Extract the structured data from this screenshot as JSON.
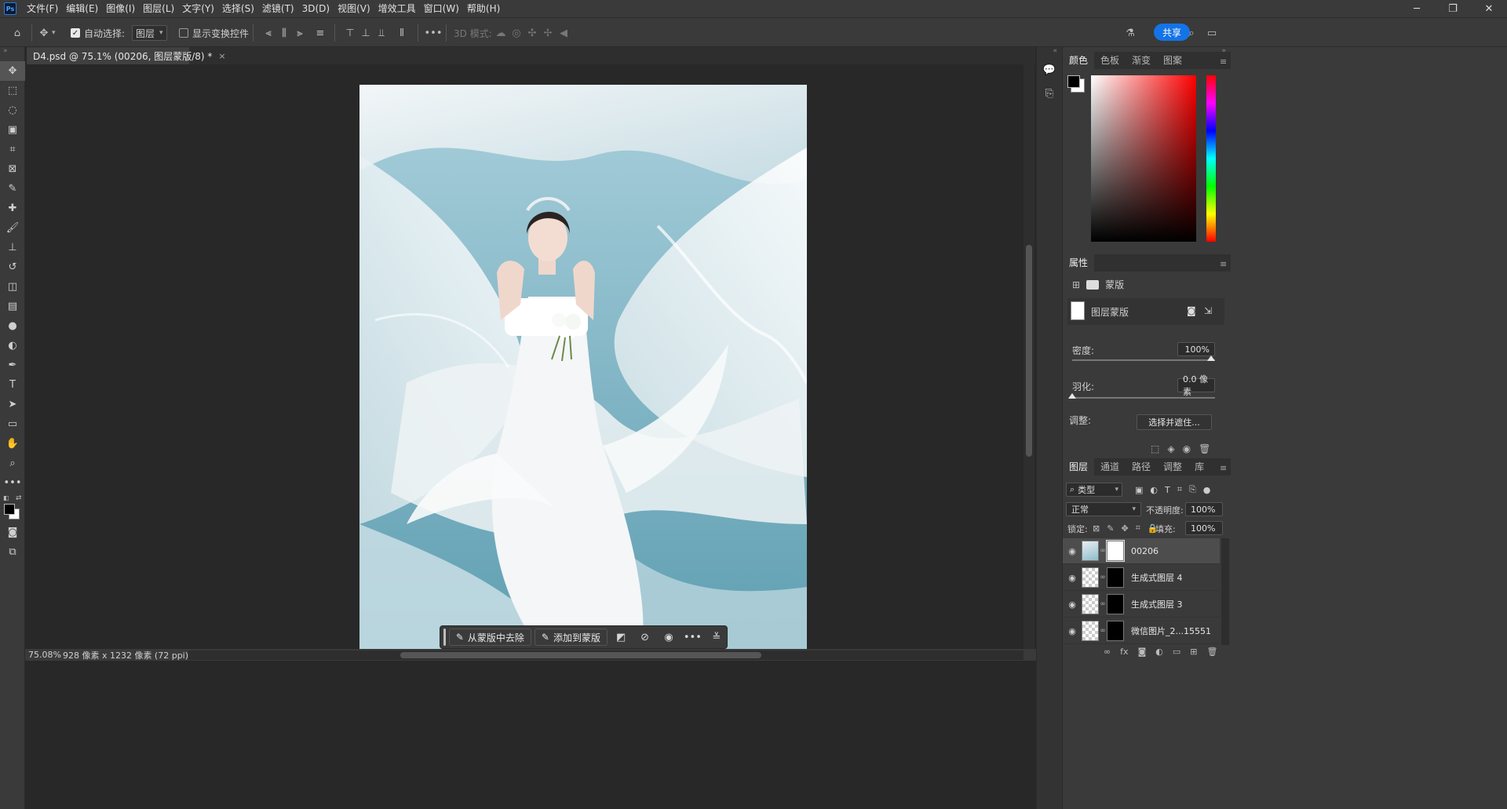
{
  "app": {
    "logo": "Ps"
  },
  "menu": [
    "文件(F)",
    "编辑(E)",
    "图像(I)",
    "图层(L)",
    "文字(Y)",
    "选择(S)",
    "滤镜(T)",
    "3D(D)",
    "视图(V)",
    "增效工具",
    "窗口(W)",
    "帮助(H)"
  ],
  "window_controls": {
    "minimize": "─",
    "restore": "❐",
    "close": "✕"
  },
  "options": {
    "auto_select_label": "自动选择:",
    "auto_select_checked": true,
    "layer_dropdown": "图层",
    "show_transform_label": "显示变换控件",
    "mode_3d_label": "3D 模式:",
    "share_label": "共享"
  },
  "document": {
    "tab_title": "D4.psd @ 75.1% (00206, 图层蒙版/8) *",
    "zoom": "75.08%",
    "size_info": "928 像素 x 1232 像素 (72 ppi)"
  },
  "context_bar": {
    "remove_label": "从蒙版中去除",
    "add_label": "添加到蒙版"
  },
  "color_panel": {
    "tabs": [
      "颜色",
      "色板",
      "渐变",
      "图案"
    ],
    "active": "颜色"
  },
  "properties": {
    "title": "属性",
    "mask_label": "蒙版",
    "layer_mask_label": "图层蒙版",
    "density_label": "密度:",
    "density_value": "100%",
    "feather_label": "羽化:",
    "feather_value": "0.0 像素",
    "adjust_label": "调整:",
    "select_mask_button": "选择并遮住..."
  },
  "layers_panel": {
    "tabs": [
      "图层",
      "通道",
      "路径",
      "调整",
      "库"
    ],
    "active": "图层",
    "filter_label": "类型",
    "blend_mode": "正常",
    "opacity_label": "不透明度:",
    "opacity_value": "100%",
    "lock_label": "锁定:",
    "fill_label": "填充:",
    "fill_value": "100%",
    "layers": [
      {
        "name": "00206",
        "selected": true
      },
      {
        "name": "生成式图层 4",
        "selected": false
      },
      {
        "name": "生成式图层 3",
        "selected": false
      },
      {
        "name": "微信图片_2...15551",
        "selected": false
      }
    ]
  },
  "colors": {
    "accent": "#1473e6",
    "panel_bg": "#3a3a3a",
    "canvas_bg": "#282828"
  }
}
